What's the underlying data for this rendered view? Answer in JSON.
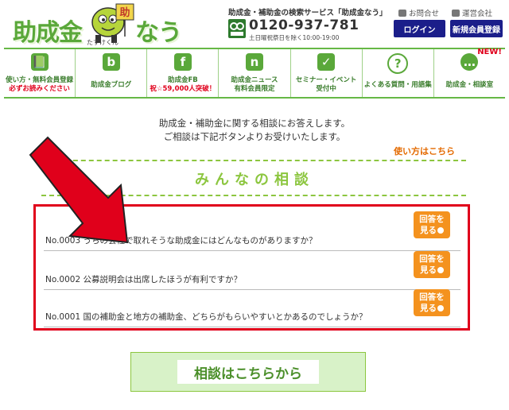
{
  "header": {
    "logo_a": "助成金",
    "logo_b": "なう",
    "mascot_tag": "助",
    "mascot_sub": "たすけくん",
    "tagline": "助成金・補助金の検索サービス「助成金なう」",
    "phone": "0120-937-781",
    "hours": "土日曜祝祭日を除く10:00-19:00",
    "contact_label": "お問合せ",
    "company_label": "運営会社",
    "login_label": "ログイン",
    "register_label": "新規会員登録"
  },
  "nav": {
    "items": [
      {
        "icon": "📗",
        "line1": "使い方・無料会員登録",
        "line2": "必ずお読みください"
      },
      {
        "icon": "b",
        "line1": "助成金ブログ",
        "line2": ""
      },
      {
        "icon": "f",
        "line1": "助成金FB",
        "line2": "祝☆59,000人突破！"
      },
      {
        "icon": "n",
        "line1": "助成金ニュース",
        "line2": "有料会員限定"
      },
      {
        "icon": "✓",
        "line1": "セミナー・イベント",
        "line2": "受付中"
      },
      {
        "icon": "?",
        "line1": "よくある質問・用語集",
        "line2": ""
      },
      {
        "icon": "…",
        "line1": "助成金・相談室",
        "line2": ""
      }
    ],
    "new_badge": "NEW!"
  },
  "intro": {
    "line1": "助成金・補助金に関する相談にお答えします。",
    "line2": "ご相談は下記ボタンよりお受けいたします。",
    "howto": "使い方はこちら"
  },
  "section_title": "みんなの相談",
  "consultations": [
    {
      "text": "No.0003 うちの会社で取れそうな助成金にはどんなものがありますか？",
      "button": "回答を見る"
    },
    {
      "text": "No.0002 公募説明会は出席したほうが有利ですか？",
      "button": "回答を見る"
    },
    {
      "text": "No.0001 国の補助金と地方の補助金、どちらがもらいやすいとかあるのでしょうか？",
      "button": "回答を見る"
    }
  ],
  "answer_line1": "回答を",
  "answer_line2": "見る",
  "cta_label": "相談はこちらから",
  "colors": {
    "brand_green": "#5aa83a",
    "accent_orange": "#f4921e",
    "highlight_red": "#e0001b",
    "nav_navy": "#1b1e8a"
  }
}
